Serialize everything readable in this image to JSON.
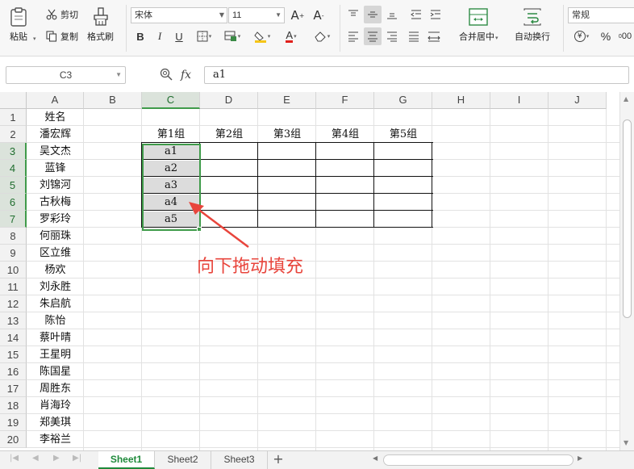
{
  "ribbon": {
    "clipboard": {
      "paste": "粘贴",
      "cut": "剪切",
      "copy": "复制",
      "format_painter": "格式刷"
    },
    "font": {
      "name": "宋体",
      "size": "11"
    },
    "merge_center": "合并居中",
    "wrap_text": "自动换行",
    "number_format": "常规",
    "currency_symbol": "¥",
    "percent_symbol": "%",
    "decimal_zeros": "00"
  },
  "formula_bar": {
    "name_box": "C3",
    "fx": "fx",
    "content": "a1"
  },
  "grid": {
    "columns": [
      "A",
      "B",
      "C",
      "D",
      "E",
      "F",
      "G",
      "H",
      "I",
      "J"
    ],
    "rows": [
      "1",
      "2",
      "3",
      "4",
      "5",
      "6",
      "7",
      "8",
      "9",
      "10",
      "11",
      "12",
      "13",
      "14",
      "15",
      "16",
      "17",
      "18",
      "19",
      "20"
    ],
    "names": [
      "姓名",
      "潘宏辉",
      "吴文杰",
      "蓝锋",
      "刘锦河",
      "古秋梅",
      "罗彩玲",
      "何丽珠",
      "区立维",
      "杨欢",
      "刘永胜",
      "朱启航",
      "陈怡",
      "蔡叶晴",
      "王星明",
      "陈国星",
      "周胜东",
      "肖海玲",
      "郑美琪",
      "李裕兰"
    ],
    "group_headers": [
      "第1组",
      "第2组",
      "第3组",
      "第4组",
      "第5组"
    ],
    "c_values": [
      "a1",
      "a2",
      "a3",
      "a4",
      "a5"
    ]
  },
  "annotation": "向下拖动填充",
  "sheets": [
    "Sheet1",
    "Sheet2",
    "Sheet3"
  ],
  "colors": {
    "accent_green": "#3f9b4a",
    "annotation_red": "#e8453c"
  }
}
